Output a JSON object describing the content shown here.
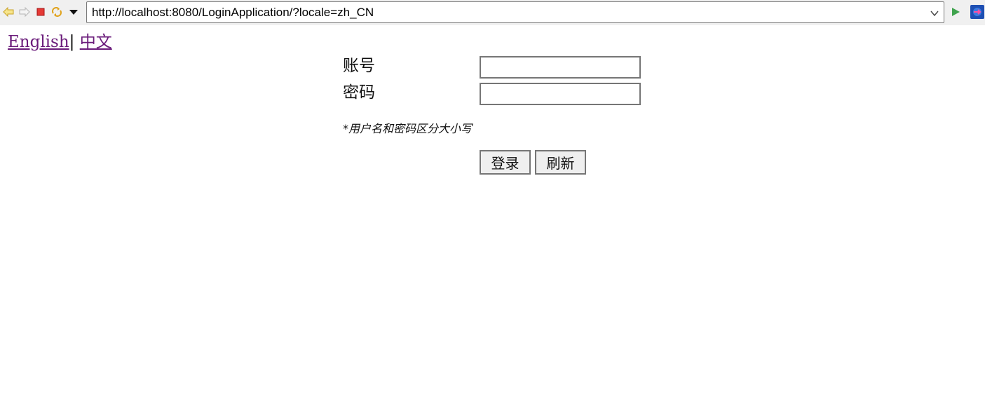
{
  "browser": {
    "url": "http://localhost:8080/LoginApplication/?locale=zh_CN",
    "icons": {
      "back": "back-arrow-icon",
      "forward": "forward-arrow-icon",
      "stop": "stop-icon",
      "refresh": "refresh-icon",
      "menu": "dropdown-triangle-icon",
      "url_dropdown": "chevron-down-icon",
      "go": "go-play-icon",
      "extra": "external-app-icon"
    }
  },
  "language_switch": {
    "english": "English",
    "separator": "|",
    "chinese": "中文"
  },
  "login_form": {
    "account_label": "账号",
    "password_label": "密码",
    "account_value": "",
    "password_value": "",
    "hint": "*用户名和密码区分大小写",
    "login_button": "登录",
    "refresh_button": "刷新"
  },
  "colors": {
    "link": "#6a1b7a",
    "toolbar_bg": "#f0f0f0",
    "border": "#767676"
  }
}
